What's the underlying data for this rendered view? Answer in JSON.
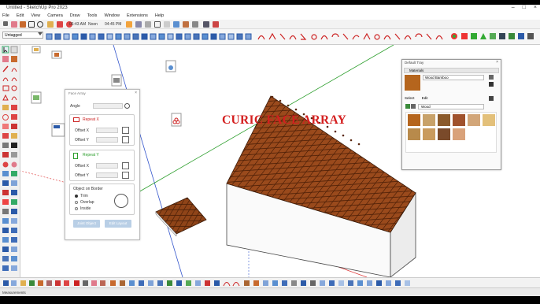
{
  "window": {
    "title": "Untitled - SketchUp Pro 2023",
    "controls": [
      "–",
      "□",
      "×"
    ]
  },
  "menu": [
    "File",
    "Edit",
    "View",
    "Camera",
    "Draw",
    "Tools",
    "Window",
    "Extensions",
    "Help"
  ],
  "toolbar": {
    "tag_select": "Untagged",
    "time_1": "06:43 AM",
    "noon": "Noon",
    "time_2": "04:45 PM"
  },
  "heading": "CURIC FACE ARRAY",
  "face_array": {
    "title": "Face Array",
    "close": "×",
    "angle_label": "Angle",
    "repeat_x": "Repeat X",
    "offset_x": "Offset X",
    "offset_y": "Offset Y",
    "repeat_y": "Repeat Y",
    "offset_x_2": "Offset X",
    "offset_y_2": "Offset Y",
    "object_on_border": "Object on Border",
    "options": [
      "Trim",
      "Overlap",
      "Inside"
    ],
    "selected_option": "Trim",
    "join_button": "Joint Object",
    "edit_button": "Edit Layout"
  },
  "tray": {
    "title": "Default Tray",
    "close": "×",
    "section": "Materials",
    "material_name": "Wood Bamboo",
    "tabs": [
      "Select",
      "Edit"
    ],
    "category": "Wood",
    "swatches": [
      "#b5651d",
      "#c8a26a",
      "#8b5a2b",
      "#a0522d",
      "#d2a679",
      "#e3c07a",
      "#b88a4b",
      "#c99b5e",
      "#7a4a2a",
      "#d9a27a"
    ]
  },
  "status": {
    "measurements": "Measurements"
  },
  "colors": {
    "roof": "#8b3e14",
    "red_axis": "#d33",
    "green_axis": "#2a9d2a",
    "blue_axis": "#3355cc",
    "heading": "#d41f1f"
  },
  "icons": [
    "select-icon",
    "eraser-icon",
    "paint-bucket-icon",
    "line-icon",
    "arc-icon",
    "rectangle-icon",
    "push-pull-icon",
    "move-icon",
    "rotate-icon",
    "scale-icon",
    "offset-icon",
    "tape-icon",
    "text-icon",
    "orbit-icon",
    "pan-icon",
    "zoom-icon"
  ]
}
